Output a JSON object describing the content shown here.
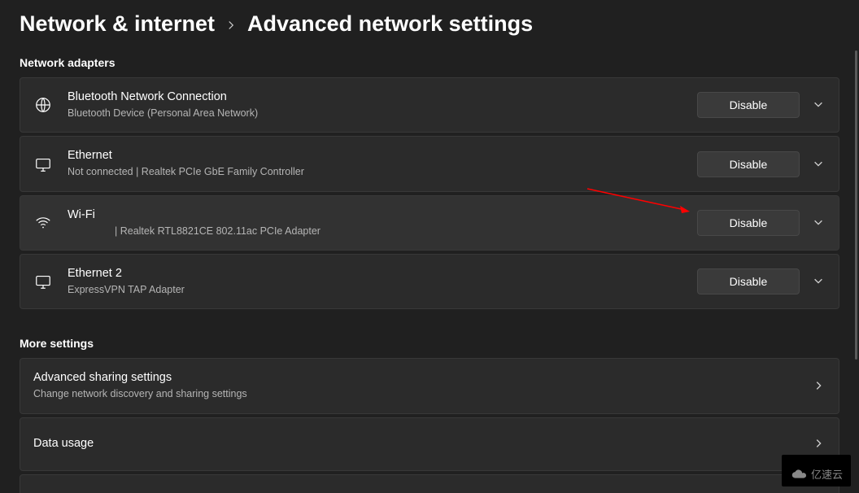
{
  "breadcrumb": {
    "parent": "Network & internet",
    "current": "Advanced network settings"
  },
  "sections": {
    "adapters_title": "Network adapters",
    "more_title": "More settings"
  },
  "adapters": [
    {
      "title": "Bluetooth Network Connection",
      "subtitle": "Bluetooth Device (Personal Area Network)",
      "button": "Disable",
      "icon": "globe"
    },
    {
      "title": "Ethernet",
      "subtitle": "Not connected | Realtek PCIe GbE Family Controller",
      "button": "Disable",
      "icon": "monitor"
    },
    {
      "title": "Wi-Fi",
      "subtitle_prefix": "",
      "subtitle": "| Realtek RTL8821CE 802.11ac PCIe Adapter",
      "button": "Disable",
      "icon": "wifi"
    },
    {
      "title": "Ethernet 2",
      "subtitle": "ExpressVPN TAP Adapter",
      "button": "Disable",
      "icon": "monitor"
    }
  ],
  "more": [
    {
      "title": "Advanced sharing settings",
      "subtitle": "Change network discovery and sharing settings"
    },
    {
      "title": "Data usage",
      "subtitle": ""
    }
  ],
  "watermark": {
    "text": "亿速云"
  },
  "colors": {
    "bg": "#202020",
    "card": "#2b2b2b",
    "card_highlight": "#323232",
    "button": "#3a3a3a",
    "text": "#ffffff",
    "subtext": "#b5b5b5",
    "arrow": "#ff0000"
  }
}
